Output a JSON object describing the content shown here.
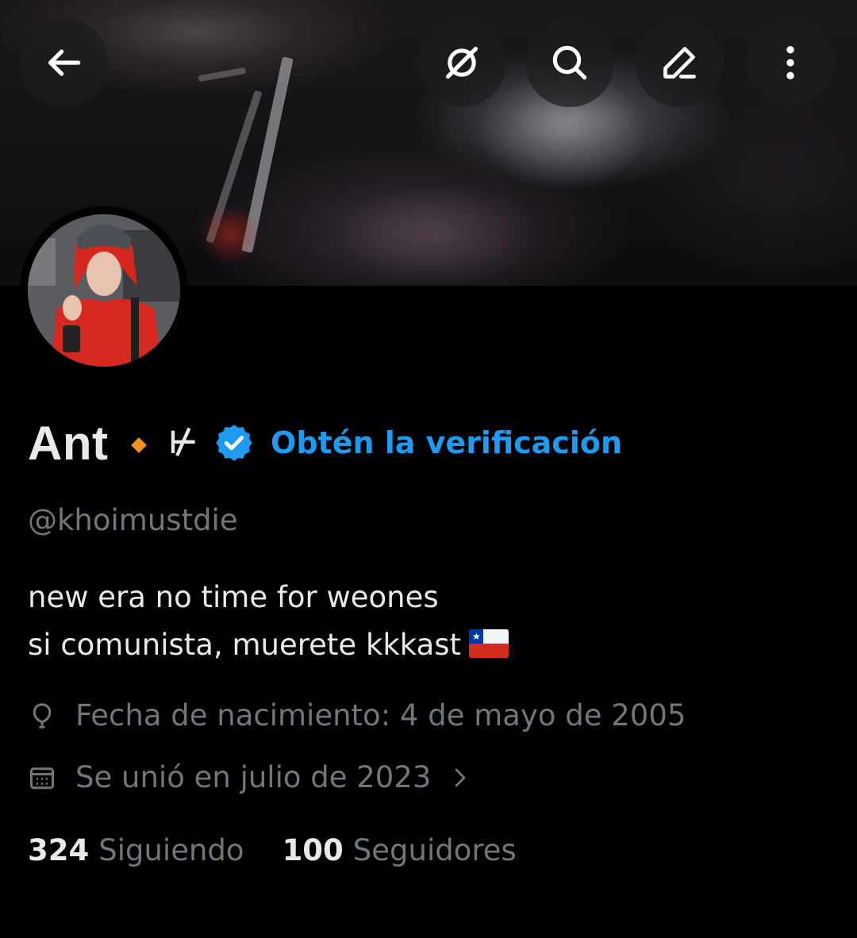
{
  "profile": {
    "display_name": "Ant",
    "name_glyph": "⊬",
    "get_verified_label": "Obtén la verificación",
    "handle": "@khoimustdie",
    "bio_lines": [
      "new era no time for weones",
      "si comunista, muerete kkkast"
    ],
    "bio_flag_icon": "chile-flag-icon",
    "birthdate": "Fecha de nacimiento: 4 de mayo de 2005",
    "joined": "Se unió en julio de 2023",
    "following_count": "324",
    "following_label": "Siguiendo",
    "followers_count": "100",
    "followers_label": "Seguidores"
  },
  "topbar": {
    "icons": [
      "back-arrow-icon",
      "grok-icon",
      "search-icon",
      "edit-pencil-icon",
      "more-vertical-icon"
    ]
  },
  "colors": {
    "background": "#000000",
    "text_primary": "#e7e9ea",
    "text_secondary": "#71767b",
    "accent_blue": "#1d9bf0",
    "diamond_orange": "#f7931a"
  }
}
